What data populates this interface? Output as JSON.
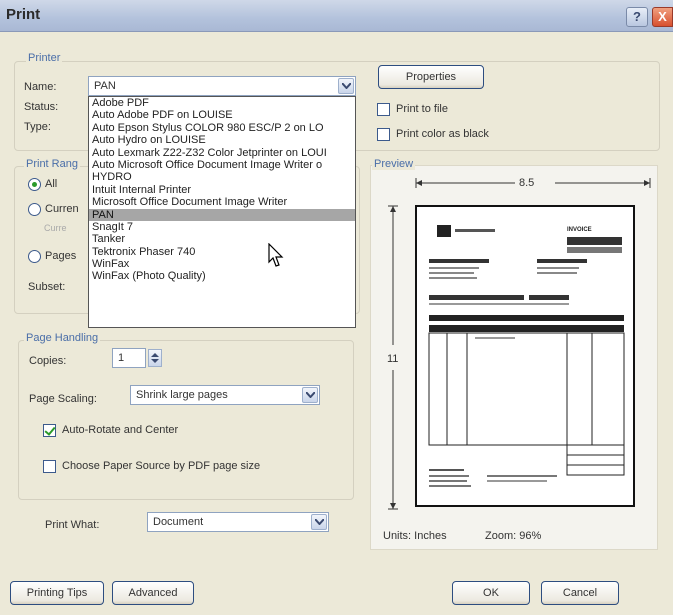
{
  "window": {
    "title": "Print",
    "help": "?",
    "close": "X"
  },
  "printer": {
    "group_label": "Printer",
    "name_label": "Name:",
    "name_value": "PAN",
    "status_label": "Status:",
    "type_label": "Type:",
    "properties_button": "Properties",
    "print_to_file": "Print to file",
    "print_color_as_black": "Print color as black",
    "printer_list": [
      "Adobe PDF",
      "Auto Adobe PDF on LOUISE",
      "Auto Epson Stylus COLOR 980 ESC/P 2 on LO",
      "Auto Hydro on LOUISE",
      "Auto Lexmark Z22-Z32 Color Jetprinter on LOUI",
      "Auto Microsoft Office Document Image Writer o",
      "HYDRO",
      "Intuit Internal Printer",
      "Microsoft Office Document Image Writer",
      "PAN",
      "SnagIt 7",
      "Tanker",
      "Tektronix Phaser 740",
      "WinFax",
      "WinFax (Photo Quality)"
    ],
    "selected_index": 9
  },
  "print_range": {
    "group_label": "Print Rang",
    "all": "All",
    "current": "Curren",
    "current_sub": "Curre",
    "pages": "Pages",
    "subset_label": "Subset:"
  },
  "page_handling": {
    "group_label": "Page Handling",
    "copies_label": "Copies:",
    "copies_value": "1",
    "scaling_label": "Page Scaling:",
    "scaling_value": "Shrink large pages",
    "auto_rotate": "Auto-Rotate and Center",
    "auto_rotate_checked": true,
    "choose_paper": "Choose Paper Source by PDF page size",
    "choose_paper_checked": false
  },
  "print_what": {
    "label": "Print What:",
    "value": "Document"
  },
  "preview": {
    "group_label": "Preview",
    "width": "8.5",
    "height": "11",
    "units": "Units: Inches",
    "zoom": "Zoom: 96%",
    "doc_title": "INVOICE"
  },
  "footer": {
    "printing_tips": "Printing Tips",
    "advanced": "Advanced",
    "ok": "OK",
    "cancel": "Cancel"
  }
}
